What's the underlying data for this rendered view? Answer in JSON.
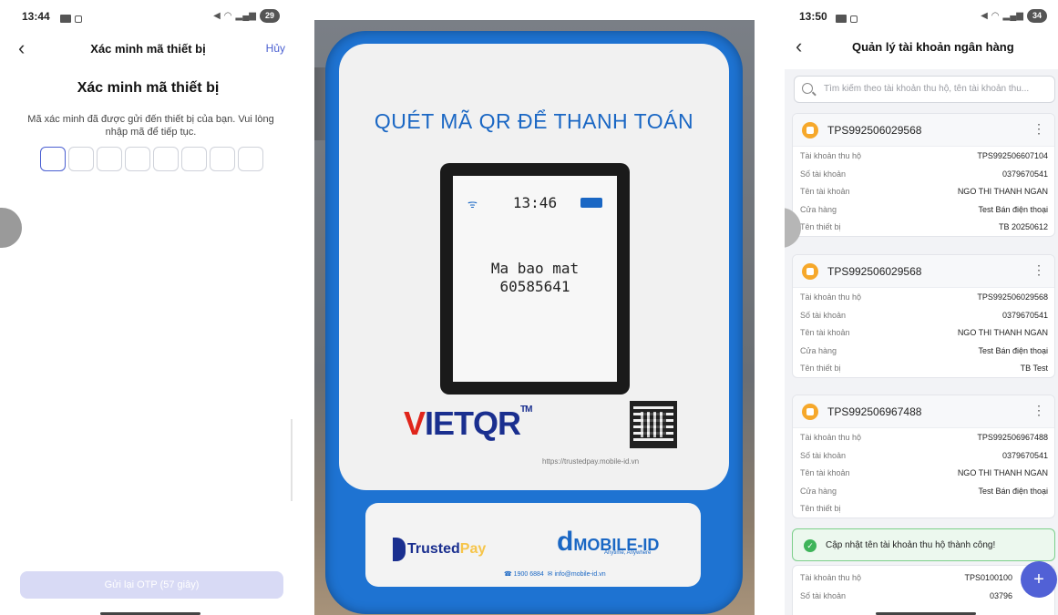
{
  "panel1": {
    "status": {
      "time": "13:44",
      "battery": "29"
    },
    "header": {
      "title": "Xác minh mã thiết bị",
      "cancel": "Hủy"
    },
    "heading": "Xác minh mã thiết bị",
    "description": "Mã xác minh đã được gửi đến thiết bị của bạn. Vui lòng nhập mã để tiếp tục.",
    "otp_boxes": 8,
    "resend_button": "Gửi lại OTP (57 giây)"
  },
  "panel2": {
    "device_title": "QUÉT MÃ QR ĐỂ THANH TOÁN",
    "lcd_time": "13:46",
    "lcd_line1": "Ma bao mat",
    "lcd_line2": "60585641",
    "brand": "VIETQR",
    "brand_tm": "TM",
    "url": "https://trustedpay.mobile-id.vn",
    "trusted": "Trusted",
    "pay": "Pay",
    "mobileid": "MOBILE-ID",
    "mobileid_sub": "Anytime, Anywhere",
    "phone": "1900 6884",
    "email": "info@mobile-id.vn"
  },
  "panel3": {
    "status": {
      "time": "13:50",
      "battery": "34"
    },
    "title": "Quản lý tài khoản ngân hàng",
    "search_placeholder": "Tìm kiếm theo tài khoản thu hộ, tên tài khoản thu...",
    "labels": {
      "collect": "Tài khoản thu hộ",
      "account_no": "Số tài khoản",
      "account_name": "Tên tài khoản",
      "store": "Cửa hàng",
      "device_name": "Tên thiết bị"
    },
    "cards": [
      {
        "name": "TPS992506029568",
        "collect": "TPS992506607104",
        "account_no": "0379670541",
        "account_name": "NGO THI THANH NGAN",
        "store": "Test Bán điện thoại",
        "device_name": "TB 20250612"
      },
      {
        "name": "TPS992506029568",
        "collect": "TPS992506029568",
        "account_no": "0379670541",
        "account_name": "NGO THI THANH NGAN",
        "store": "Test Bán điện thoại",
        "device_name": "TB Test"
      },
      {
        "name": "TPS992506967488",
        "collect": "TPS992506967488",
        "account_no": "0379670541",
        "account_name": "NGO THI THANH NGAN",
        "store": "Test Bán điện thoại",
        "device_name": ""
      }
    ],
    "partial_card": {
      "collect": "TPS0100100",
      "account_no": "03796"
    },
    "toast": "Cập nhật tên tài khoản thu hộ thành công!",
    "fab_label": "+"
  }
}
